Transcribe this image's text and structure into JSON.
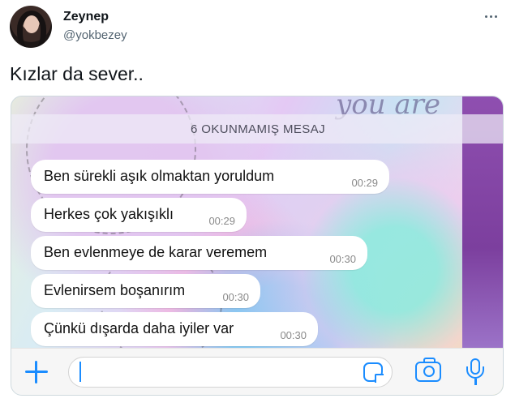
{
  "tweet": {
    "author_name": "Zeynep",
    "author_handle": "@yokbezey",
    "text": "Kızlar da sever..",
    "more_icon": "more-horizontal-icon"
  },
  "chat": {
    "unread_banner": "6 OKUNMAMIŞ MESAJ",
    "messages": [
      {
        "text": "Ben sürekli aşık olmaktan yoruldum",
        "time": "00:29"
      },
      {
        "text": "Herkes çok yakışıklı",
        "time": "00:29"
      },
      {
        "text": "Ben evlenmeye de karar veremem",
        "time": "00:30"
      },
      {
        "text": "Evlenirsem boşanırım",
        "time": "00:30"
      },
      {
        "text": "Çünkü dışarda daha iyiler var",
        "time": "00:30"
      }
    ],
    "input": {
      "value": "",
      "icons": [
        "plus-icon",
        "sticker-icon",
        "camera-icon",
        "microphone-icon"
      ]
    },
    "accent_color": "#1a8cff"
  }
}
